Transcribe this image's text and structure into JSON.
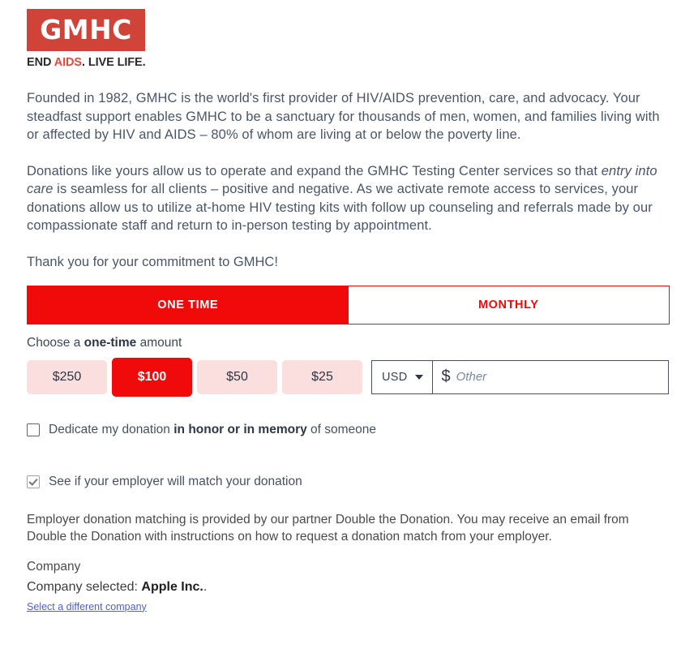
{
  "logo": {
    "mark": "GMHC",
    "tagline_pre": "END ",
    "tagline_accent": "AIDS",
    "tagline_post": ". LIVE LIFE.",
    "box_color": "#cf4338",
    "accent_color": "#e8483a"
  },
  "intro": {
    "paragraph1": "Founded in 1982, GMHC is the world's first provider of HIV/AIDS prevention, care, and advocacy. Your steadfast support enables GMHC to be a sanctuary for thousands of men, women, and families living with or affected by HIV and AIDS – 80% of whom are living at or below the poverty line.",
    "paragraph2_a": "Donations like yours allow us to operate and expand the GMHC Testing Center services so that ",
    "paragraph2_italic": "entry into care",
    "paragraph2_b": " is seamless for all clients – positive and negative. As we activate remote access to services, your donations allow us to utilize at-home HIV testing kits with follow up counseling and referrals made by our compassionate staff and return to in-person testing by appointment.",
    "thanks": "Thank you for your commitment to GMHC!"
  },
  "frequency": {
    "one_time_label": "ONE TIME",
    "monthly_label": "MONTHLY",
    "selected": "ONE TIME",
    "active_color": "#f00a0a"
  },
  "amount": {
    "choose_prefix": "Choose a ",
    "choose_bold": "one-time",
    "choose_suffix": " amount",
    "presets": [
      {
        "label": "$250",
        "value": 250,
        "selected": false
      },
      {
        "label": "$100",
        "value": 100,
        "selected": true
      },
      {
        "label": "$50",
        "value": 50,
        "selected": false
      },
      {
        "label": "$25",
        "value": 25,
        "selected": false
      }
    ],
    "currency": "USD",
    "currency_symbol": "$",
    "other_placeholder": "Other",
    "other_value": "",
    "preset_color": "#fbdfdf",
    "selected_color": "#f00a0a"
  },
  "dedicate": {
    "checked": false,
    "label_pre": "Dedicate my donation ",
    "label_bold": "in honor or in memory",
    "label_post": " of someone"
  },
  "employer_match": {
    "checked": true,
    "label": "See if your employer will match your donation",
    "description": "Employer donation matching is provided by our partner Double the Donation. You may receive an email from Double the Donation with instructions on how to request a donation match from your employer.",
    "company_field_label": "Company",
    "company_selected_prefix": "Company selected: ",
    "company_name": "Apple Inc.",
    "company_selected_suffix": ".",
    "change_company_link": "Select a different company",
    "link_color": "#4a5fd8"
  }
}
